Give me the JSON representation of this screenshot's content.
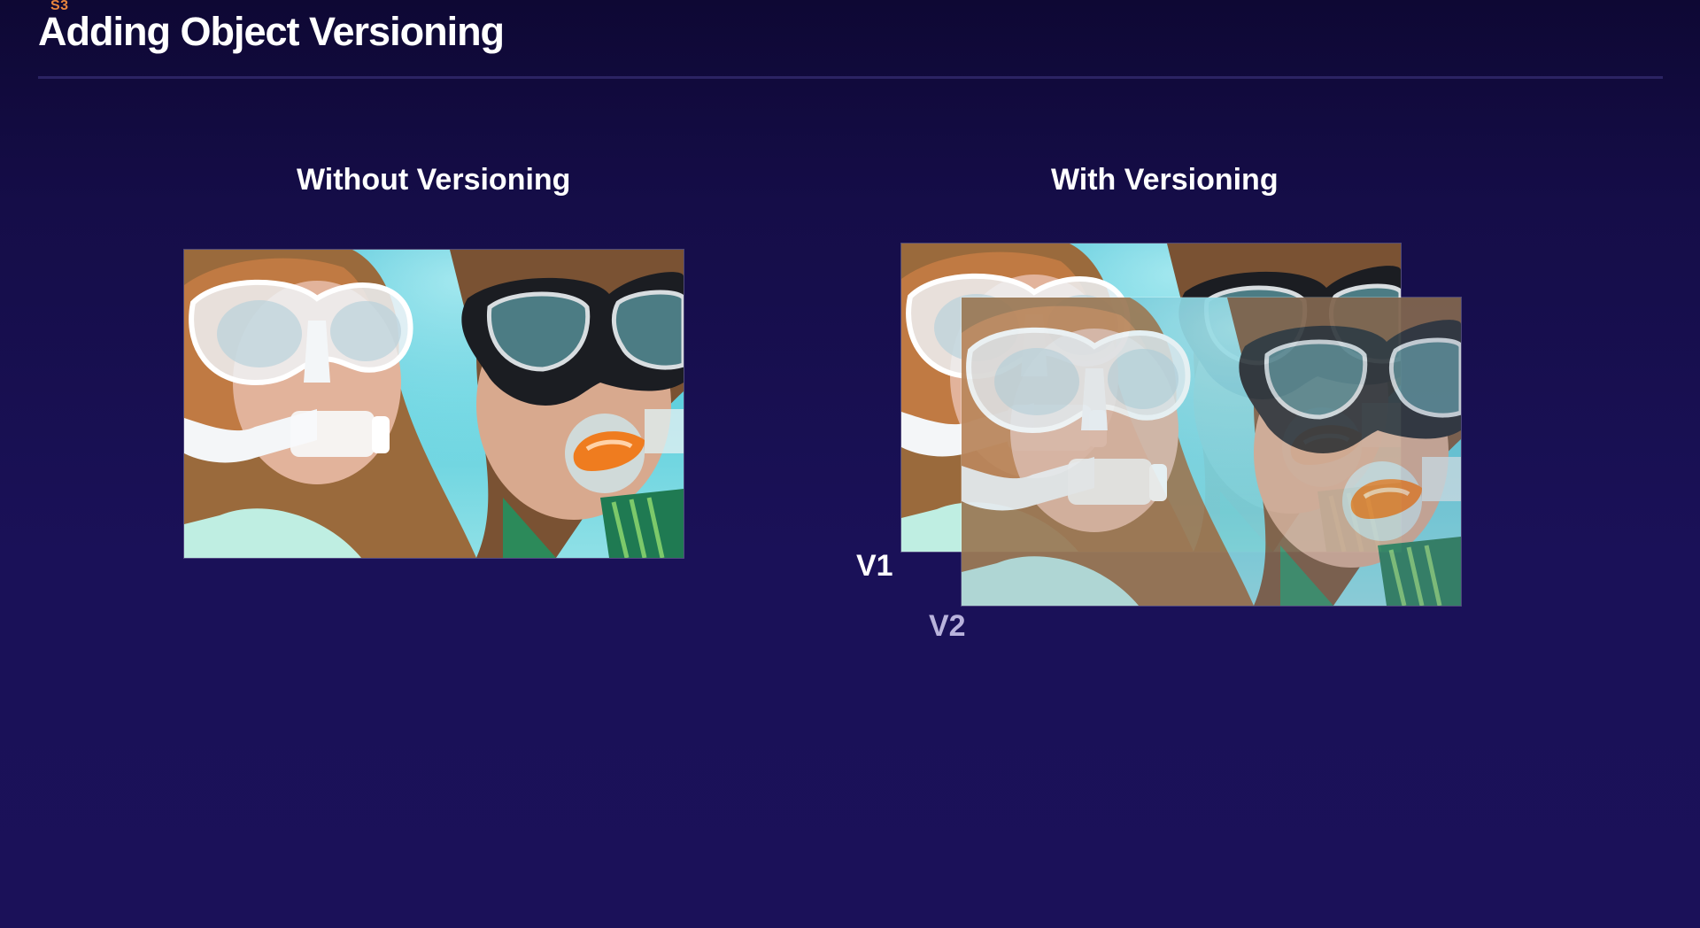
{
  "slide": {
    "eyebrow": "S3",
    "title": "Adding Object Versioning"
  },
  "columns": {
    "left": {
      "heading": "Without Versioning"
    },
    "right": {
      "heading": "With Versioning"
    }
  },
  "versions": {
    "v1_label": "V1",
    "v2_label": "V2"
  },
  "colors": {
    "background": "#1a1158",
    "eyebrow": "#e8853c",
    "title": "#ffffff",
    "v2_label": "#b9b3dc",
    "water": "#4fc6d9"
  },
  "icons": {
    "photo": "underwater-snorkel-photo"
  }
}
